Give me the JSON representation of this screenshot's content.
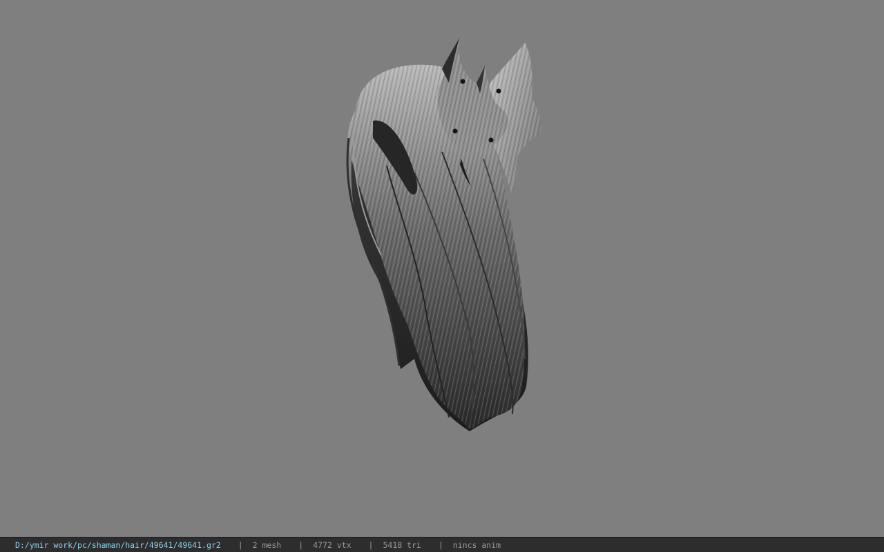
{
  "viewer": {
    "background_color": "#7f7f7f",
    "model": {
      "icon": "hair-model-icon"
    }
  },
  "status": {
    "path": "D:/ymir work/pc/shaman/hair/49641/49641.gr2",
    "separator": "|",
    "mesh": "2 mesh",
    "vertices": "4772 vtx",
    "triangles": "5418 tri",
    "anim": "nincs anim",
    "path_color": "#8fd0e8"
  }
}
